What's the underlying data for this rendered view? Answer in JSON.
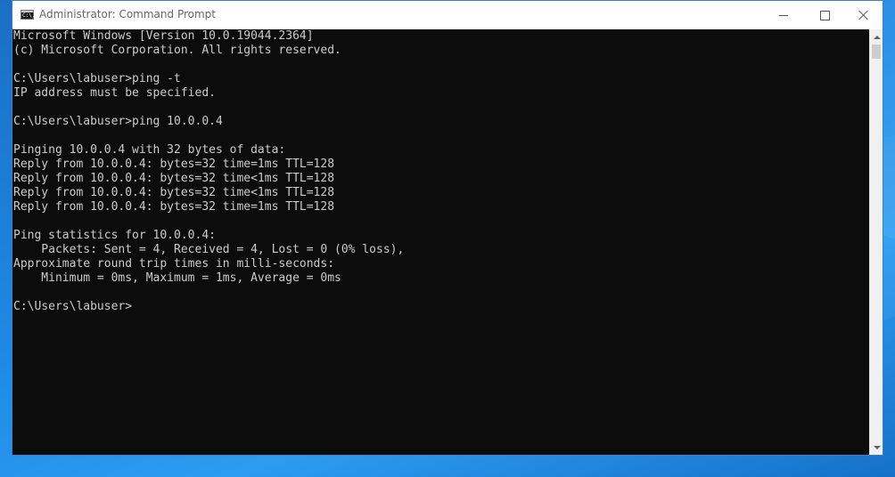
{
  "window": {
    "title": "Administrator: Command Prompt",
    "icon": "cmd-icon",
    "icon_glyph": "C:\\."
  },
  "titlebar_buttons": {
    "minimize": "minimize-icon",
    "maximize": "maximize-icon",
    "close": "close-icon"
  },
  "console": {
    "background": "#0c0c0c",
    "foreground": "#cccccc",
    "lines": [
      "Microsoft Windows [Version 10.0.19044.2364]",
      "(c) Microsoft Corporation. All rights reserved.",
      "",
      "C:\\Users\\labuser>ping -t",
      "IP address must be specified.",
      "",
      "C:\\Users\\labuser>ping 10.0.0.4",
      "",
      "Pinging 10.0.0.4 with 32 bytes of data:",
      "Reply from 10.0.0.4: bytes=32 time=1ms TTL=128",
      "Reply from 10.0.0.4: bytes=32 time<1ms TTL=128",
      "Reply from 10.0.0.4: bytes=32 time<1ms TTL=128",
      "Reply from 10.0.0.4: bytes=32 time=1ms TTL=128",
      "",
      "Ping statistics for 10.0.0.4:",
      "    Packets: Sent = 4, Received = 4, Lost = 0 (0% loss),",
      "Approximate round trip times in milli-seconds:",
      "    Minimum = 0ms, Maximum = 1ms, Average = 0ms",
      "",
      "C:\\Users\\labuser>"
    ]
  },
  "scrollbar": {
    "up": "scroll-up-arrow-icon",
    "down": "scroll-down-arrow-icon"
  },
  "desktop": {
    "accent": "#1e8ae6"
  }
}
